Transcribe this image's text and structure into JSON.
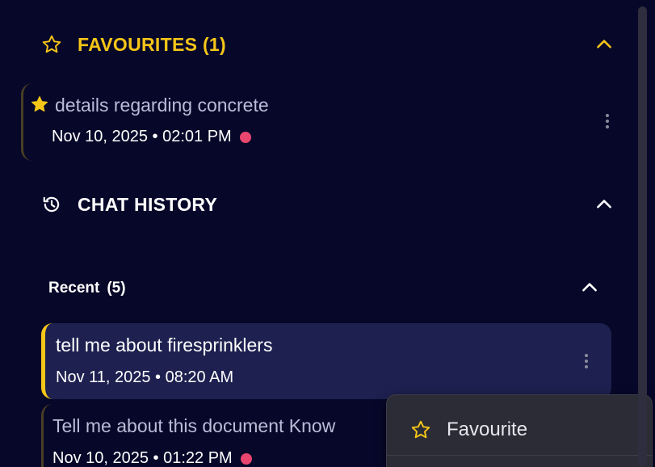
{
  "colors": {
    "background": "#07072a",
    "accent": "#f5c518",
    "active_item_bg": "#1e2150",
    "status_dot": "#e8456f",
    "menu_bg": "#2b2c35"
  },
  "favourites": {
    "icon": "star-outline-icon",
    "title": "FAVOURITES (1)",
    "collapse_icon": "chevron-up-icon",
    "items": [
      {
        "icon": "star-filled-icon",
        "title": "details regarding concrete",
        "meta": "Nov 10, 2025 • 02:01 PM",
        "menu_icon": "kebab-menu-icon"
      }
    ]
  },
  "chat_history": {
    "icon": "history-icon",
    "title": "CHAT HISTORY",
    "collapse_icon": "chevron-up-icon",
    "recent": {
      "label": "Recent",
      "count": "(5)",
      "collapse_icon": "chevron-up-icon"
    },
    "items": [
      {
        "title": "tell me about firesprinklers",
        "meta": "Nov 11, 2025 • 08:20 AM",
        "active": true
      },
      {
        "title": "Tell me about this document Know",
        "meta": "Nov 10, 2025 • 01:22 PM",
        "active": false
      }
    ]
  },
  "context_menu": {
    "items": [
      {
        "icon": "star-outline-icon",
        "label": "Favourite"
      }
    ]
  }
}
